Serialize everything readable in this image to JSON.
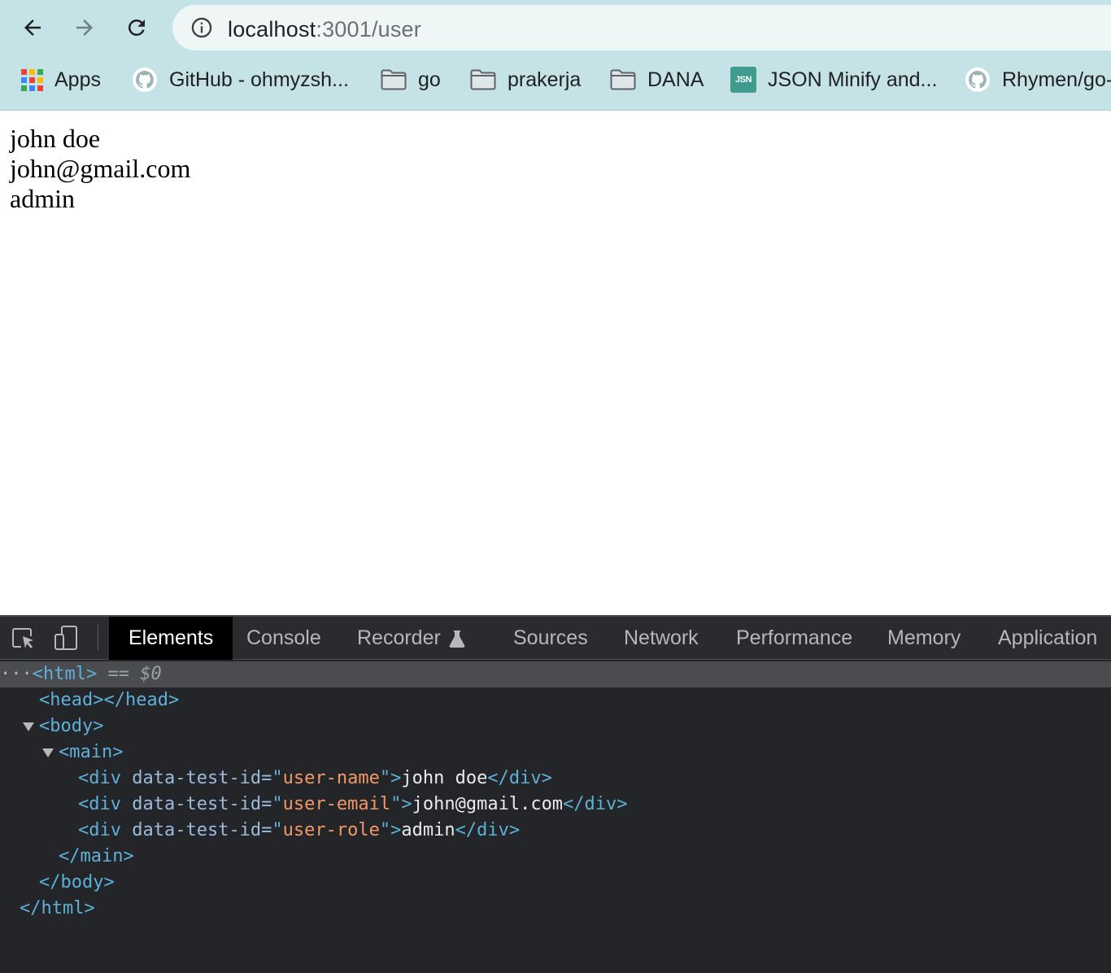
{
  "browser": {
    "url_host": "localhost",
    "url_path": ":3001/user",
    "bookmarks": [
      {
        "label": "Apps",
        "icon": "apps-grid-icon"
      },
      {
        "label": "GitHub - ohmyzsh...",
        "icon": "github-icon"
      },
      {
        "label": "go",
        "icon": "folder-icon"
      },
      {
        "label": "prakerja",
        "icon": "folder-icon"
      },
      {
        "label": "DANA",
        "icon": "folder-icon"
      },
      {
        "label": "JSON Minify and...",
        "icon": "jsn-icon",
        "icon_text": "JSN"
      },
      {
        "label": "Rhymen/go-",
        "icon": "github-icon"
      }
    ]
  },
  "page": {
    "user_name": "john doe",
    "user_email": "john@gmail.com",
    "user_role": "admin"
  },
  "devtools": {
    "tabs": [
      "Elements",
      "Console",
      "Recorder",
      "Sources",
      "Network",
      "Performance",
      "Memory",
      "Application"
    ],
    "active_tab": "Elements",
    "dom": {
      "selected_suffix": "== $0",
      "html_open": "<html>",
      "head": "<head></head>",
      "body_open": "<body>",
      "main_open": "<main>",
      "div_open": "<div",
      "attr_name": "data-test-id=",
      "rows": [
        {
          "value": "user-name",
          "text": "john doe"
        },
        {
          "value": "user-email",
          "text": "john@gmail.com"
        },
        {
          "value": "user-role",
          "text": "admin"
        }
      ],
      "div_close": "</div>",
      "main_close": "</main>",
      "body_close": "</body>",
      "html_close": "</html>"
    }
  },
  "colors": {
    "chrome_bg": "#c5e3e6",
    "devtools_bg": "#242528",
    "tag_color": "#5db0d7",
    "attr_value_color": "#f29766"
  }
}
